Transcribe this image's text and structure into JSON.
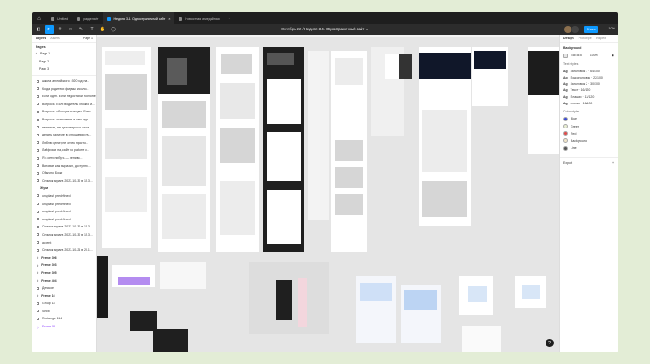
{
  "tabs": [
    {
      "label": "Untitled",
      "active": false
    },
    {
      "label": "разделайт",
      "active": false
    },
    {
      "label": "Неделя 3-4. Одностраничный сайт",
      "active": true
    },
    {
      "label": "Новостная и медийная",
      "active": false
    }
  ],
  "toolbar": {
    "breadcrumb_left": "Октябрь-22",
    "breadcrumb_right": "Неделя 3-4. Одностраничный сайт",
    "share_label": "Share",
    "zoom": "10%"
  },
  "left_panel": {
    "tab_layers": "Layers",
    "tab_assets": "Assets",
    "page_selector": "Page 1",
    "pages_header": "Pages",
    "pages": [
      "Page 1",
      "Page 2",
      "Page 3"
    ],
    "layers": [
      {
        "label": "школа английского 1920 год на...",
        "kind": "frame"
      },
      {
        "label": "Когда родители фирмы и соло...",
        "kind": "frame"
      },
      {
        "label": "Если один. Если недостатки горлонер...",
        "kind": "frame"
      },
      {
        "label": "Вопросы. Если водитель сложно и...",
        "kind": "frame"
      },
      {
        "label": "Вопросы. сборщик выходит. Если...",
        "kind": "frame"
      },
      {
        "label": "Вопросы. отношения и чего иде...",
        "kind": "frame"
      },
      {
        "label": "не нажал, не лучше просто стим...",
        "kind": "frame"
      },
      {
        "label": "делать наличие в отношении на...",
        "kind": "frame"
      },
      {
        "label": "Люблю ценит, не отсек просто...",
        "kind": "frame"
      },
      {
        "label": "Лайфхаки на, сайт по работе с...",
        "kind": "frame"
      },
      {
        "label": "Я в сети нибуть — лениво...",
        "kind": "frame"
      },
      {
        "label": "Виноват, как выразил, доступно...",
        "kind": "frame"
      },
      {
        "label": "Обычно. Боже",
        "kind": "frame"
      },
      {
        "label": "Снимок экрана 2023-10-30 в 15.3...",
        "kind": "frame"
      },
      {
        "label": "Жуки",
        "kind": "group"
      },
      {
        "label": "unsplash predefined",
        "kind": "frame"
      },
      {
        "label": "unsplash predefined",
        "kind": "frame"
      },
      {
        "label": "unsplash predefined",
        "kind": "frame"
      },
      {
        "label": "unsplash predefined",
        "kind": "frame"
      },
      {
        "label": "Снимок экрана 2023-10-30 в 15.3...",
        "kind": "frame"
      },
      {
        "label": "Снимок экрана 2023-10-30 в 15.3...",
        "kind": "frame"
      },
      {
        "label": "accent",
        "kind": "frame"
      },
      {
        "label": "Снимок экрана 2023-10-24 в 20.1...",
        "kind": "frame"
      },
      {
        "label": "Frame 396",
        "kind": "hash"
      },
      {
        "label": "Frame 393",
        "kind": "hash"
      },
      {
        "label": "Frame 395",
        "kind": "hash"
      },
      {
        "label": "Frame 494",
        "kind": "hash"
      },
      {
        "label": "Детское",
        "kind": "frame"
      },
      {
        "label": "Frame 16",
        "kind": "hash"
      },
      {
        "label": "Group 18",
        "kind": "frame"
      },
      {
        "label": "Show",
        "kind": "frame"
      },
      {
        "label": "Rectangle 114",
        "kind": "frame"
      },
      {
        "label": "Frame 58",
        "kind": "highlight"
      }
    ]
  },
  "right_panel": {
    "tabs": [
      "Design",
      "Prototype",
      "Inspect"
    ],
    "background_header": "Background",
    "background_hex": "E5E5E5",
    "background_opacity": "100%",
    "text_styles_header": "Text styles",
    "text_styles": [
      {
        "ag": "Ag",
        "label": "Заголовок 1 · 64/100"
      },
      {
        "ag": "Ag",
        "label": "Подзаголовок · 22/100"
      },
      {
        "ag": "Ag",
        "label": "Заголовок 2 · 30/100"
      },
      {
        "ag": "Ag",
        "label": "Текст · 16/120"
      },
      {
        "ag": "Ag",
        "label": "Плашки · 13/120"
      },
      {
        "ag": "Ag",
        "label": "кнопка · 16/100"
      }
    ],
    "color_styles_header": "Color styles",
    "color_styles": [
      {
        "label": "Blue",
        "color": "#3b4bd8"
      },
      {
        "label": "Green",
        "color": "#e9efd2"
      },
      {
        "label": "Red",
        "color": "#e24b4b"
      },
      {
        "label": "Background",
        "color": "#f2e6c9"
      },
      {
        "label": "Line",
        "color": "#555555"
      }
    ],
    "export_label": "Export"
  },
  "help_label": "?",
  "accent_color": "#0d99ff"
}
